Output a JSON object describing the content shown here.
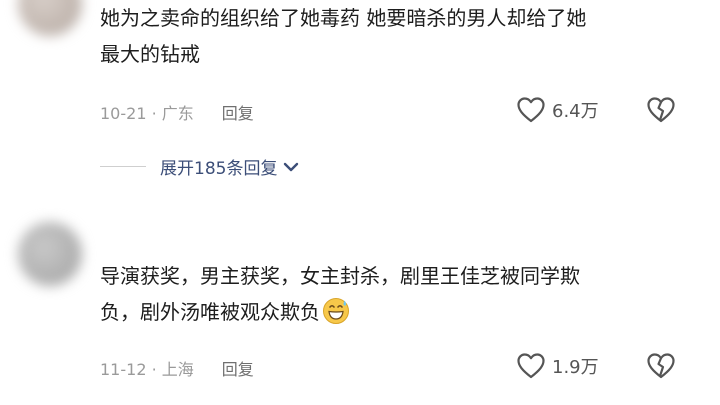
{
  "comments": [
    {
      "text": "她为之卖命的组织给了她毒药 她要暗杀的男人却给了她\n最大的钻戒",
      "date": "10-21",
      "location": "广东",
      "reply_label": "回复",
      "likes": "6.4万",
      "like_icon": "heart-outline-icon",
      "dislike_icon": "broken-heart-icon"
    },
    {
      "text": "导演获奖，男主获奖，女主封杀，剧里王佳芝被同学欺\n负，剧外汤唯被观众欺负",
      "emoji": "grinning-sweat-emoji",
      "date": "11-12",
      "location": "上海",
      "reply_label": "回复",
      "likes": "1.9万",
      "like_icon": "heart-outline-icon",
      "dislike_icon": "broken-heart-icon"
    }
  ],
  "expand_replies": {
    "label": "展开185条回复",
    "icon": "chevron-down-icon",
    "accent_color": "#3c4e78"
  }
}
